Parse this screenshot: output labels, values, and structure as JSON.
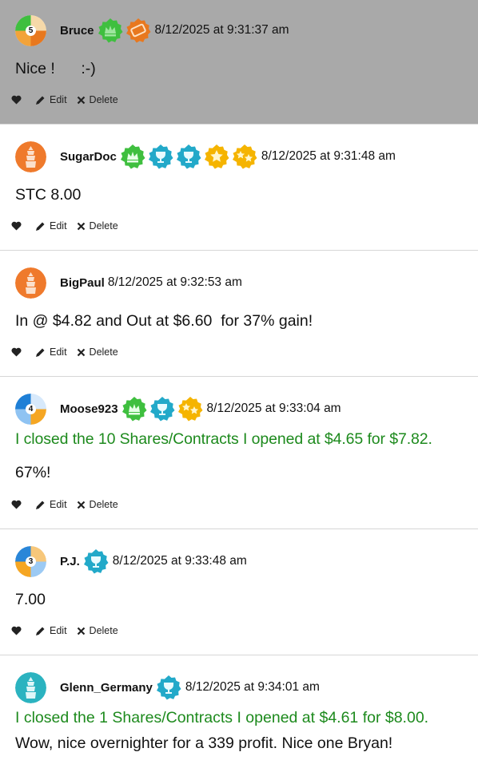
{
  "actions": {
    "edit_label": "Edit",
    "delete_label": "Delete"
  },
  "posts": [
    {
      "username": "Bruce",
      "timestamp": "8/12/2025 at 9:31:37 am",
      "rank": "5",
      "lines": [
        "Nice !      :-)"
      ],
      "badges": [
        "crown-badge-green",
        "ticket-badge-orange"
      ],
      "highlighted": true
    },
    {
      "username": "SugarDoc",
      "timestamp": "8/12/2025 at 9:31:48 am",
      "lines": [
        "STC 8.00"
      ],
      "badges": [
        "crown-badge-green",
        "trophy-badge-teal",
        "trophy-badge-teal",
        "star-badge-gold",
        "stars-badge-gold"
      ]
    },
    {
      "username": "BigPaul",
      "timestamp": "8/12/2025 at 9:32:53 am",
      "lines": [
        "In @ $4.82 and Out at $6.60  for 37% gain!"
      ],
      "badges": []
    },
    {
      "username": "Moose923",
      "timestamp": "8/12/2025 at 9:33:04 am",
      "rank": "4",
      "lines_green": [
        "I closed the 10 Shares/Contracts I opened at $4.65 for $7.82."
      ],
      "lines": [
        "67%!"
      ],
      "badges": [
        "crown-badge-green",
        "trophy-badge-teal",
        "stars-badge-gold"
      ]
    },
    {
      "username": "P.J.",
      "timestamp": "8/12/2025 at 9:33:48 am",
      "rank": "3",
      "lines": [
        "7.00"
      ],
      "badges": [
        "trophy-badge-teal"
      ]
    },
    {
      "username": "Glenn_Germany",
      "timestamp": "8/12/2025 at 9:34:01 am",
      "lines_green": [
        "I closed the 1 Shares/Contracts I opened at $4.61 for $8.00."
      ],
      "lines": [
        "Wow, nice overnighter for a 339 profit. Nice one Bryan!"
      ],
      "badges": [
        "trophy-badge-teal"
      ]
    }
  ],
  "colors": {
    "highlight_bg": "#a9a9a9",
    "green_text": "#1d8a1d",
    "orange_avatar": "#ef7a2c",
    "teal_avatar": "#2bb3c0",
    "crown_green": "#3fbf3f",
    "trophy_teal": "#22a9c9",
    "star_gold": "#f5b400",
    "ticket_orange": "#e8781e"
  }
}
